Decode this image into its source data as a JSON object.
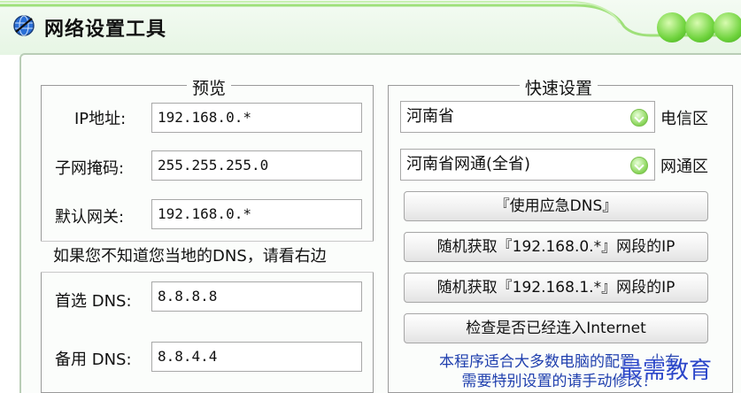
{
  "window": {
    "title": "网络设置工具",
    "accent": "#6fd33d"
  },
  "preview": {
    "legend": "预览",
    "ip_label": "IP地址:",
    "ip_value": "192.168.0.*",
    "mask_label": "子网掩码:",
    "mask_value": "255.255.255.0",
    "gateway_label": "默认网关:",
    "gateway_value": "192.168.0.*",
    "notice": "如果您不知道您当地的DNS，请看右边",
    "dns1_label": "首选 DNS:",
    "dns1_value": "8.8.8.8",
    "dns2_label": "备用 DNS:",
    "dns2_value": "8.8.4.4"
  },
  "quick": {
    "legend": "快速设置",
    "province_value": "河南省",
    "province_zone": "电信区",
    "isp_value": "河南省网通(全省)",
    "isp_zone": "网通区",
    "btn_emergency": "『使用应急DNS』",
    "btn_random0": "随机获取『192.168.0.*』网段的IP",
    "btn_random1": "随机获取『192.168.1.*』网段的IP",
    "btn_check": "检查是否已经连入Internet",
    "footer_line1": "本程序适合大多数电脑的配置，少有",
    "footer_line2": "需要特别设置的请手动修改！"
  },
  "watermark": "最需教育"
}
